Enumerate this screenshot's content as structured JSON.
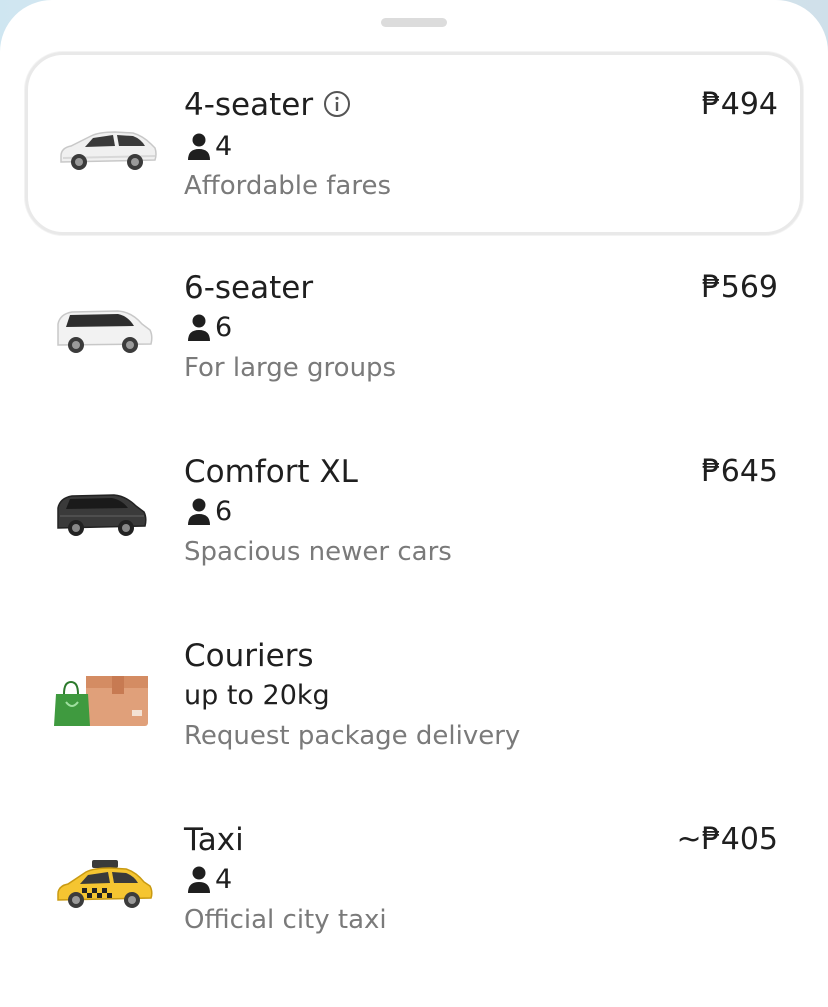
{
  "options": [
    {
      "name": "4-seater",
      "seats": "4",
      "desc": "Affordable fares",
      "price": "₱494",
      "info": true,
      "vehicle": "sedan-white-icon"
    },
    {
      "name": "6-seater",
      "seats": "6",
      "desc": "For large groups",
      "price": "₱569",
      "vehicle": "minivan-white-icon"
    },
    {
      "name": "Comfort XL",
      "seats": "6",
      "desc": "Spacious newer cars",
      "price": "₱645",
      "vehicle": "minivan-black-icon"
    },
    {
      "name": "Couriers",
      "weight": "up to 20kg",
      "desc": "Request package delivery",
      "vehicle": "package-icon"
    },
    {
      "name": "Taxi",
      "seats": "4",
      "desc": "Official city taxi",
      "price": "~₱405",
      "vehicle": "taxi-icon"
    }
  ],
  "colors": {
    "text": "#1f1f1f",
    "subtext": "#7a7a7a",
    "selected_border": "#e9e9e9",
    "taxi_yellow": "#f5c531"
  }
}
